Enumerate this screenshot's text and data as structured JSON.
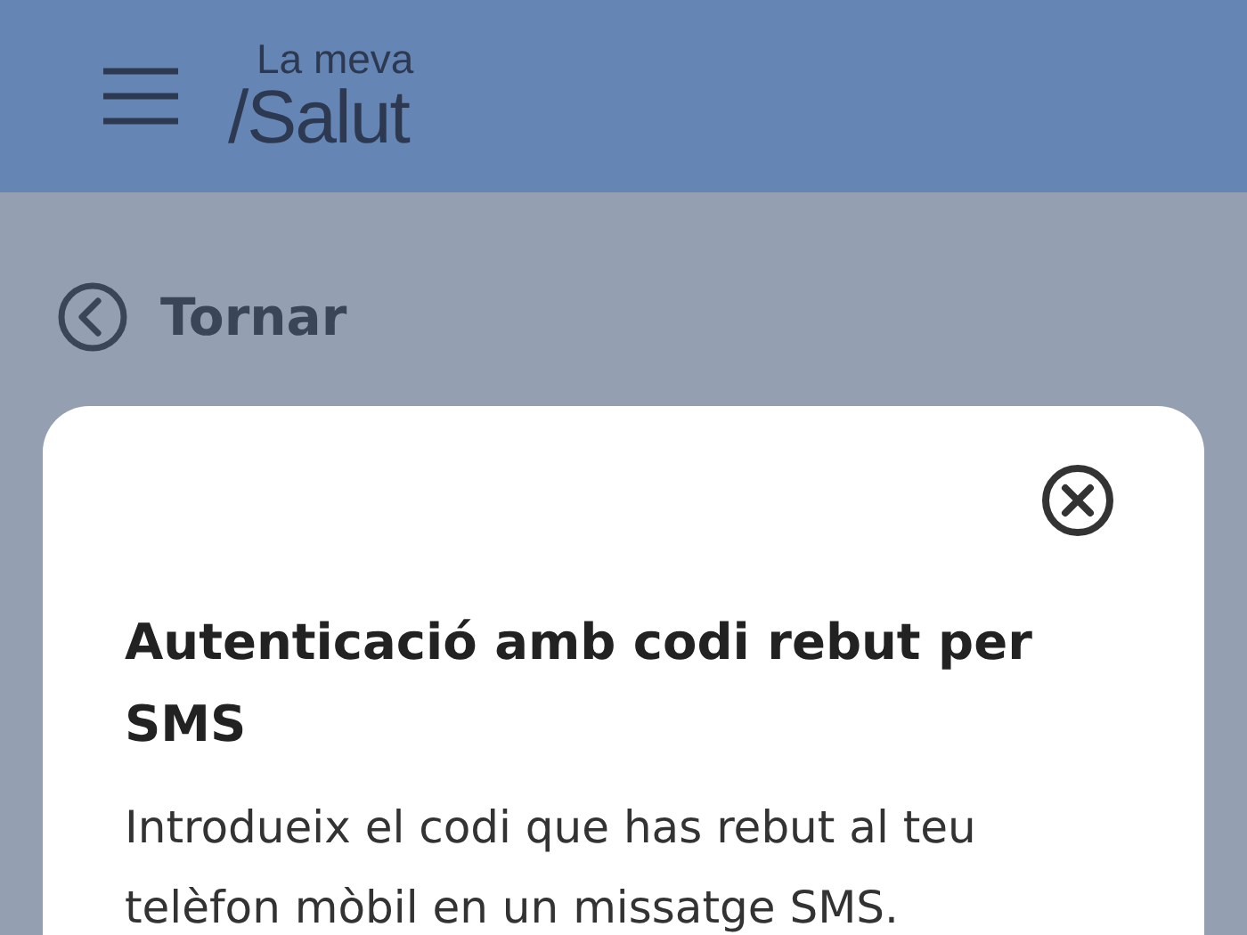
{
  "header": {
    "logo_top": "La meva",
    "logo_bottom": "/Salut"
  },
  "back_link": {
    "label": "Tornar"
  },
  "dialog": {
    "title": "Autenticació amb codi rebut per SMS",
    "body": "Introdueix el codi que has rebut al teu telèfon mòbil en un missatge SMS."
  }
}
